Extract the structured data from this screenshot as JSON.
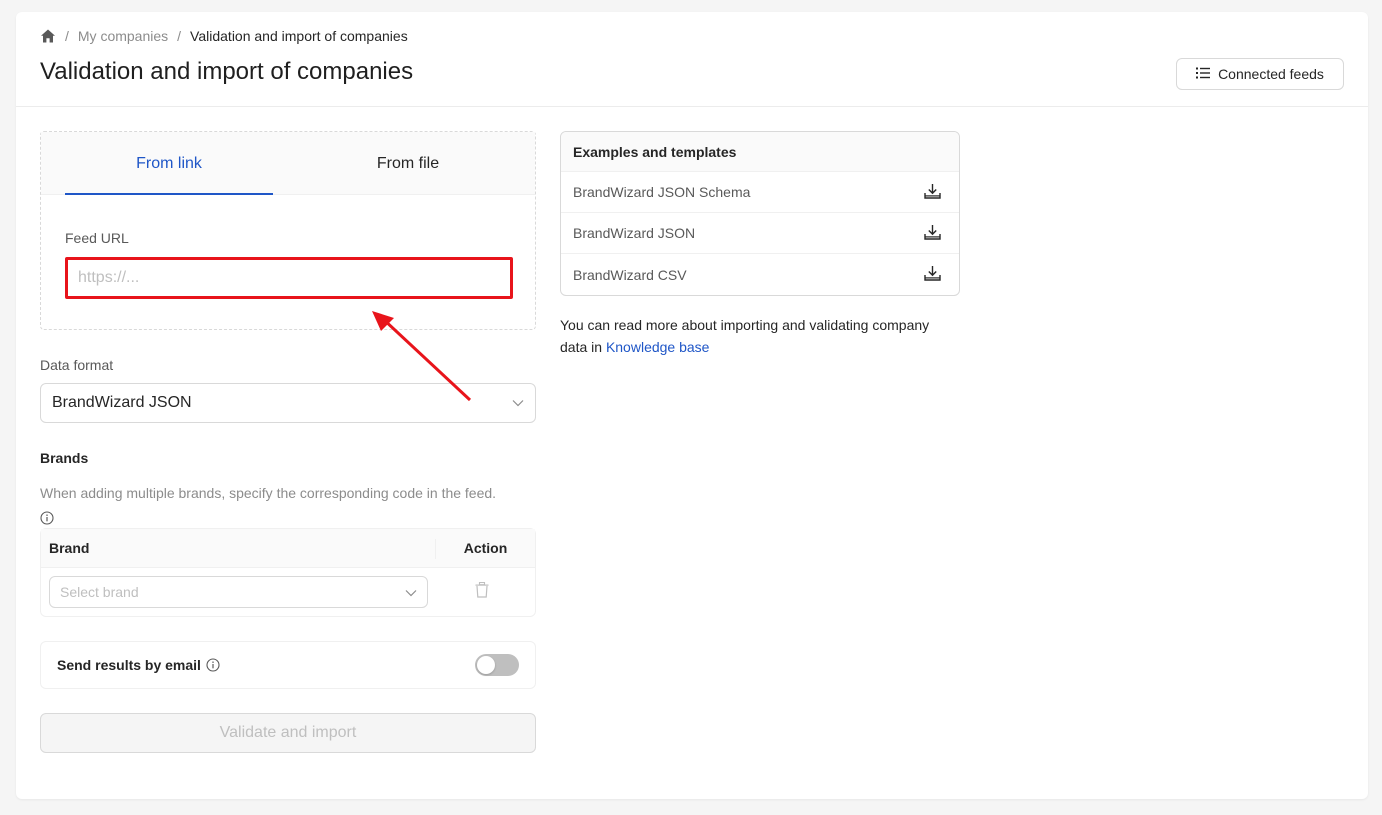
{
  "breadcrumb": {
    "home_icon": "home-icon",
    "separator": "/",
    "items": [
      "My companies",
      "Validation and import of companies"
    ]
  },
  "header": {
    "title": "Validation and import of companies",
    "connected_feeds_label": "Connected feeds",
    "connected_feeds_icon": "list-icon"
  },
  "source_tabs": {
    "items": [
      {
        "label": "From link",
        "active": true
      },
      {
        "label": "From file",
        "active": false
      }
    ]
  },
  "feed_url": {
    "label": "Feed URL",
    "placeholder": "https://...",
    "value": ""
  },
  "data_format": {
    "label": "Data format",
    "value": "BrandWizard JSON"
  },
  "brands": {
    "title": "Brands",
    "hint": "When adding multiple brands, specify the corresponding code in the feed.",
    "columns": [
      "Brand",
      "Action"
    ],
    "select_placeholder": "Select brand"
  },
  "email": {
    "label": "Send results by email",
    "enabled": false
  },
  "validate_button_label": "Validate and import",
  "examples": {
    "title": "Examples and templates",
    "items": [
      "BrandWizard JSON Schema",
      "BrandWizard JSON",
      "BrandWizard CSV"
    ]
  },
  "knowledge": {
    "text": "You can read more about importing and validating company data in",
    "link_label": "Knowledge base"
  },
  "colors": {
    "accent": "#1f56c7",
    "highlight": "#e8141b"
  }
}
